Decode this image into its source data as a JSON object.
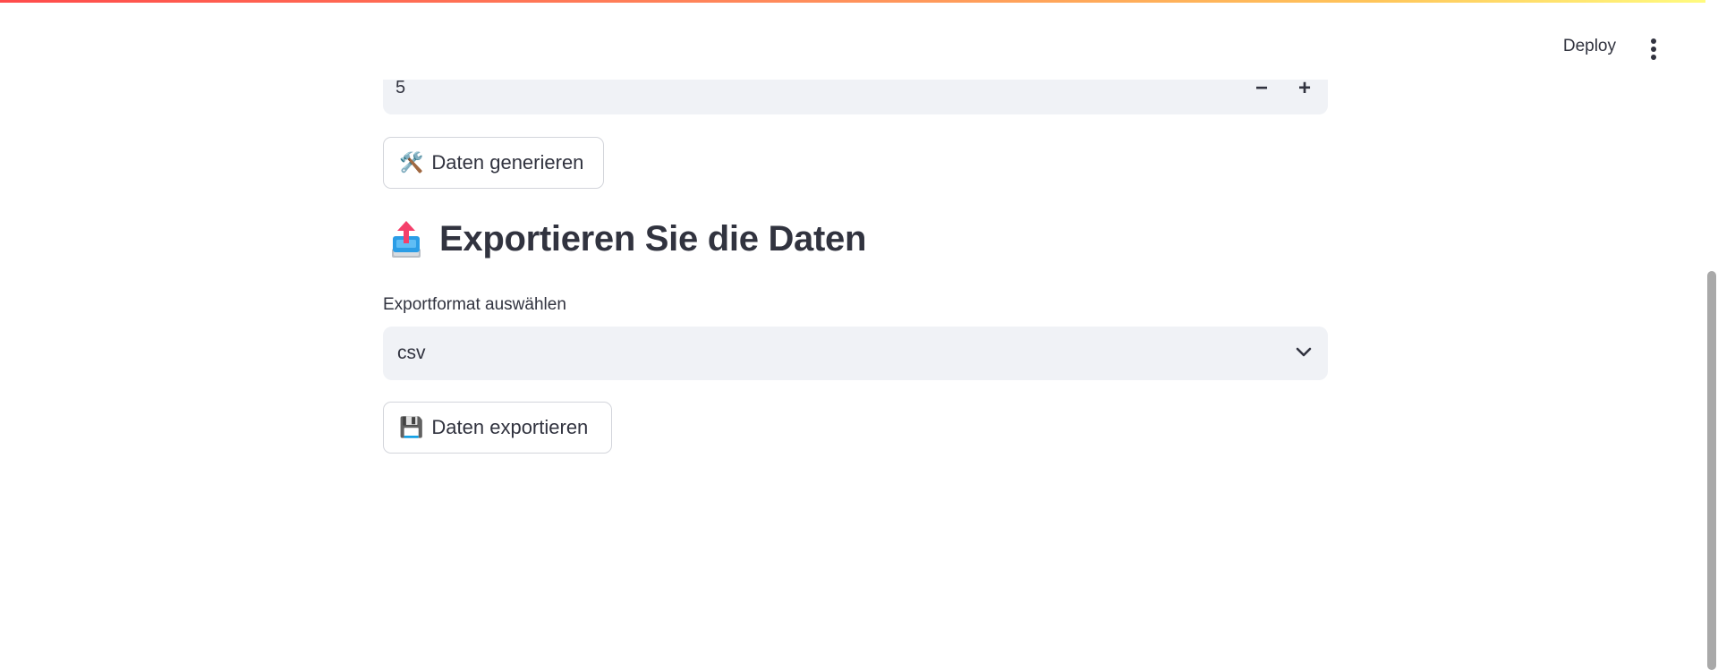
{
  "header": {
    "deploy_label": "Deploy",
    "menu_icon": "more-vertical-icon"
  },
  "number_input": {
    "value": "5",
    "decrement_label": "−",
    "increment_label": "+"
  },
  "generate_button": {
    "emoji": "🛠️",
    "label": "Daten generieren"
  },
  "export_section": {
    "icon": "outbox-tray-icon",
    "title": "Exportieren Sie die Daten",
    "select_label": "Exportformat auswählen",
    "selected_format": "csv",
    "export_button_emoji": "💾",
    "export_button_label": "Daten exportieren"
  },
  "colors": {
    "accent_gradient_start": "#ff4b4b",
    "accent_gradient_end": "#fffd80",
    "text": "#31333f",
    "input_bg": "#f0f2f6"
  }
}
